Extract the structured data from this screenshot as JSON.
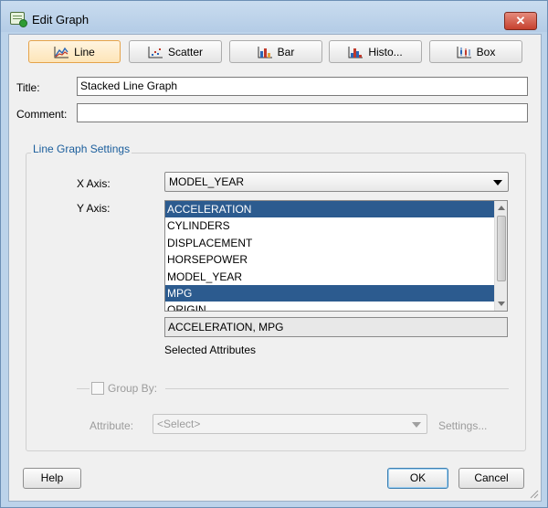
{
  "window": {
    "title": "Edit Graph",
    "close_label": "✕"
  },
  "tabs": [
    {
      "label": "Line",
      "icon": "line-chart-icon"
    },
    {
      "label": "Scatter",
      "icon": "scatter-chart-icon"
    },
    {
      "label": "Bar",
      "icon": "bar-chart-icon"
    },
    {
      "label": "Histo...",
      "icon": "histogram-icon"
    },
    {
      "label": "Box",
      "icon": "box-plot-icon"
    }
  ],
  "form": {
    "title_label": "Title:",
    "title_value": "Stacked Line Graph",
    "comment_label": "Comment:",
    "comment_value": ""
  },
  "settings": {
    "group_title": "Line Graph Settings",
    "x_axis_label": "X Axis:",
    "x_axis_value": "MODEL_YEAR",
    "y_axis_label": "Y Axis:",
    "y_axis_items": [
      {
        "label": "ACCELERATION",
        "selected": true
      },
      {
        "label": "CYLINDERS",
        "selected": false
      },
      {
        "label": "DISPLACEMENT",
        "selected": false
      },
      {
        "label": "HORSEPOWER",
        "selected": false
      },
      {
        "label": "MODEL_YEAR",
        "selected": false
      },
      {
        "label": "MPG",
        "selected": true
      },
      {
        "label": "ORIGIN",
        "selected": false
      }
    ],
    "selected_value": "ACCELERATION, MPG",
    "selected_caption": "Selected Attributes",
    "group_by_label": "Group By:",
    "attribute_label": "Attribute:",
    "attribute_value": "<Select>",
    "settings_link": "Settings..."
  },
  "buttons": {
    "help": "Help",
    "ok": "OK",
    "cancel": "Cancel"
  },
  "colors": {
    "selection": "#2c5b8f",
    "active_tab": "#fde5b8",
    "accent_text": "#1b5e9c"
  }
}
